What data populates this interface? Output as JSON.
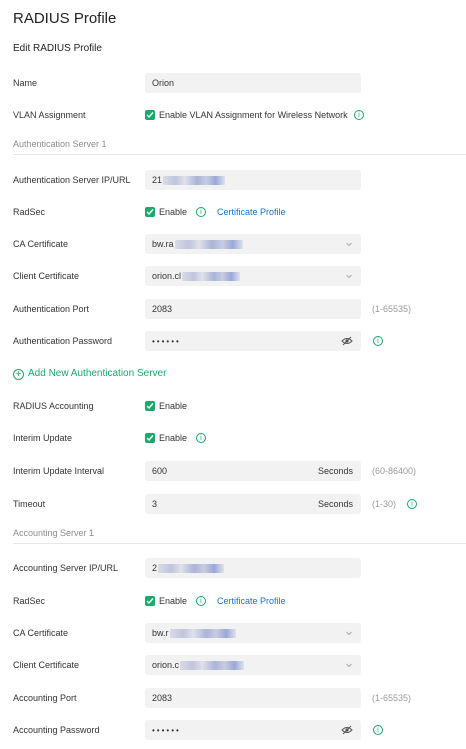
{
  "page": {
    "title": "RADIUS Profile",
    "subtitle": "Edit RADIUS Profile"
  },
  "colors": {
    "accent": "#1aa96b",
    "link": "#1b6fc9",
    "field_bg": "#f2f2f2"
  },
  "fields": {
    "name": {
      "label": "Name",
      "value": "Orion"
    },
    "vlan": {
      "label": "VLAN Assignment",
      "checkbox_label": "Enable VLAN Assignment for Wireless Network",
      "checked": true
    }
  },
  "auth_server": {
    "section_title": "Authentication Server 1",
    "ip": {
      "label": "Authentication Server IP/URL",
      "value": "21"
    },
    "radsec": {
      "label": "RadSec",
      "checkbox_label": "Enable",
      "checked": true,
      "link": "Certificate Profile"
    },
    "ca_cert": {
      "label": "CA Certificate",
      "value": "bw.ra"
    },
    "client_cert": {
      "label": "Client Certificate",
      "value": "orion.cl"
    },
    "port": {
      "label": "Authentication Port",
      "value": "2083",
      "hint": "(1-65535)"
    },
    "password": {
      "label": "Authentication Password",
      "value": "••••••"
    }
  },
  "add_server_label": "Add New Authentication Server",
  "accounting": {
    "label": "RADIUS Accounting",
    "checkbox_label": "Enable",
    "checked": true
  },
  "interim": {
    "label": "Interim Update",
    "checkbox_label": "Enable",
    "checked": true
  },
  "interim_interval": {
    "label": "Interim Update Interval",
    "value": "600",
    "suffix": "Seconds",
    "hint": "(60-86400)"
  },
  "timeout": {
    "label": "Timeout",
    "value": "3",
    "suffix": "Seconds",
    "hint": "(1-30)"
  },
  "acct_server": {
    "section_title": "Accounting Server 1",
    "ip": {
      "label": "Accounting Server IP/URL",
      "value": "2"
    },
    "radsec": {
      "label": "RadSec",
      "checkbox_label": "Enable",
      "checked": true,
      "link": "Certificate Profile"
    },
    "ca_cert": {
      "label": "CA Certificate",
      "value": "bw.r"
    },
    "client_cert": {
      "label": "Client Certificate",
      "value": "orion.c"
    },
    "port": {
      "label": "Accounting Port",
      "value": "2083",
      "hint": "(1-65535)"
    },
    "password": {
      "label": "Accounting Password",
      "value": "••••••"
    }
  },
  "icons": {
    "info": "info-circle-icon",
    "eye": "eye-off-icon",
    "chevron": "chevron-down-icon",
    "check": "checkmark-icon",
    "plus": "plus-circle-icon"
  }
}
